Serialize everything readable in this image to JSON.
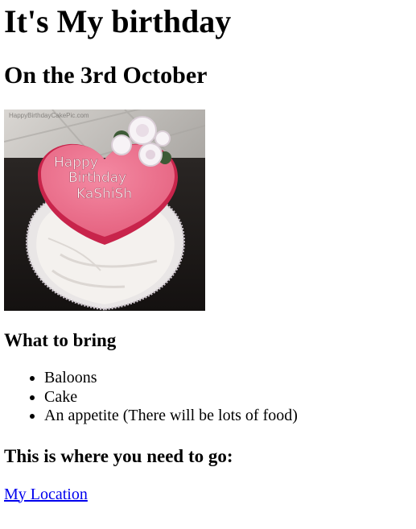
{
  "page": {
    "title": "It's My birthday",
    "subtitle": "On the 3rd October"
  },
  "image": {
    "watermark": "HappyBirthdayCakePic.com",
    "cake_text_line1": "Happy",
    "cake_text_line2": "Birthday",
    "cake_text_line3": "KaShiSh"
  },
  "bring": {
    "heading": "What to bring",
    "items": [
      "Baloons",
      "Cake",
      "An appetite (There will be lots of food)"
    ]
  },
  "location": {
    "heading": "This is where you need to go:",
    "link_text": "My Location"
  },
  "colors": {
    "link": "#0000ee",
    "cake_pink": "#e8607f",
    "frosting": "#f4f1ee"
  }
}
